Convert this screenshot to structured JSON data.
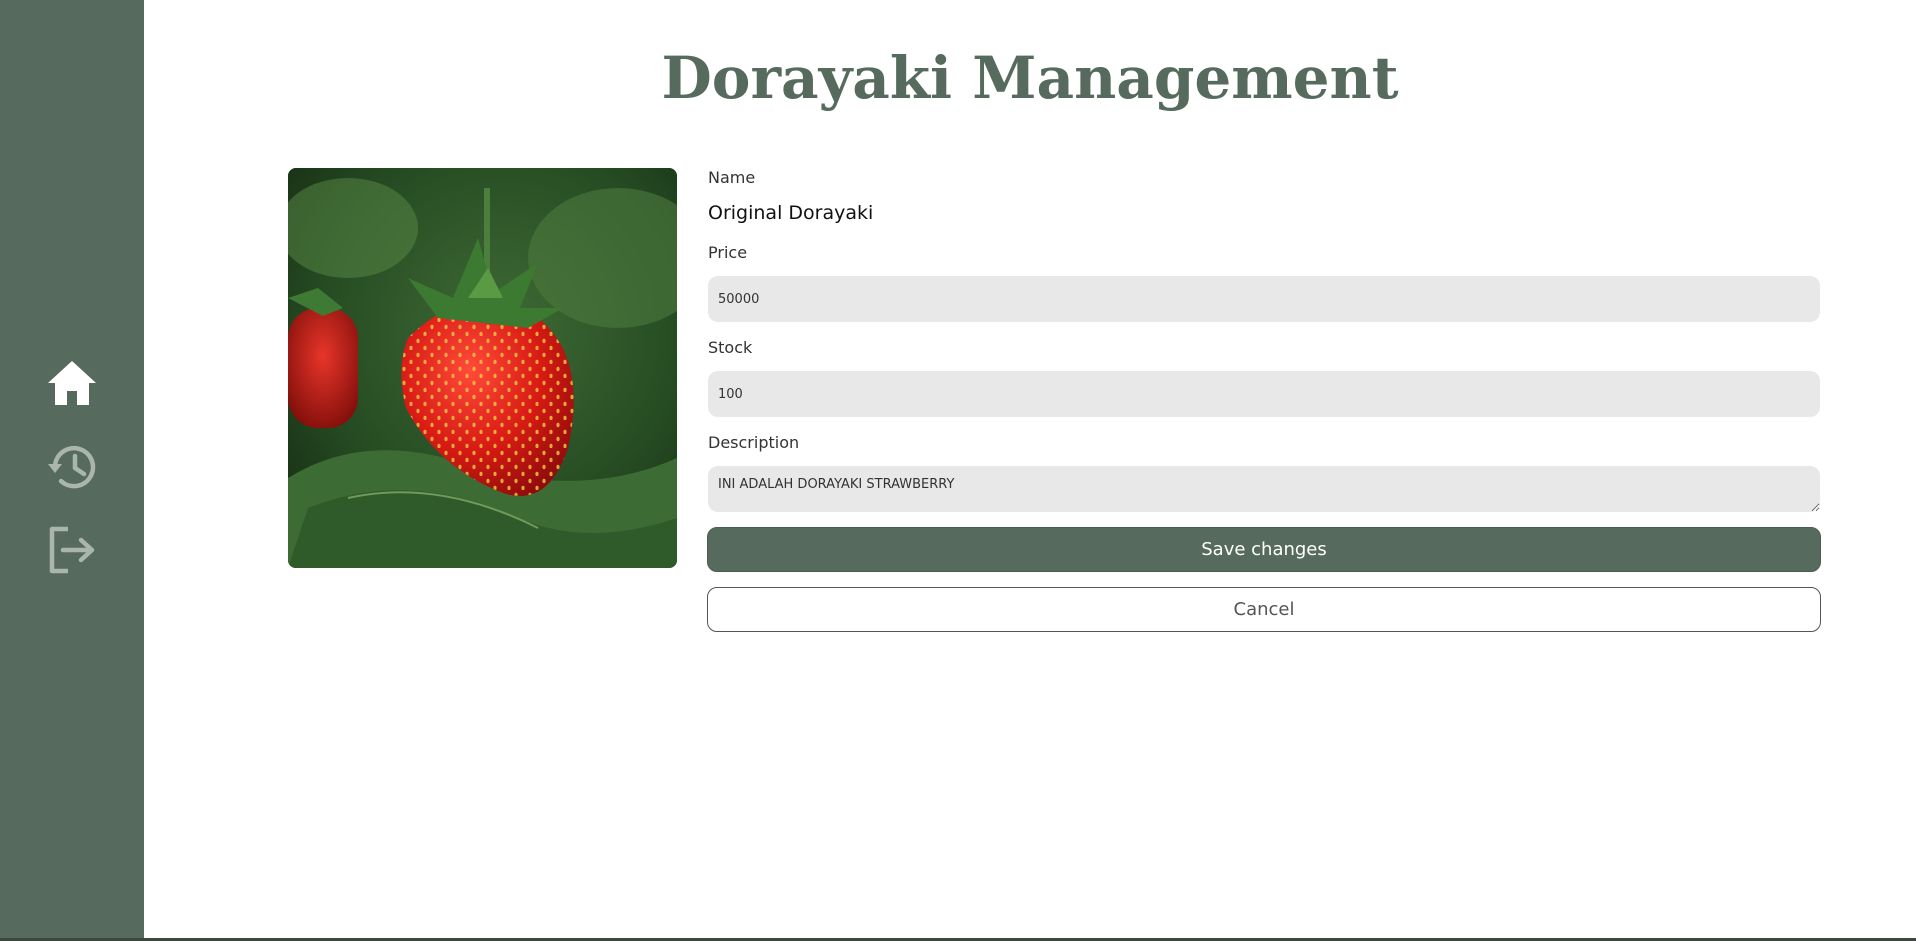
{
  "app": {
    "title": "Dorayaki Management"
  },
  "sidebar": {
    "items": [
      {
        "name": "home",
        "icon": "home-icon",
        "active": true
      },
      {
        "name": "history",
        "icon": "history-icon",
        "active": false
      },
      {
        "name": "logout",
        "icon": "logout-icon",
        "active": false
      }
    ]
  },
  "product": {
    "image_icon": "strawberry-photo"
  },
  "form": {
    "name_label": "Name",
    "name_value": "Original Dorayaki",
    "price_label": "Price",
    "price_value": "50000",
    "stock_label": "Stock",
    "stock_value": "100",
    "description_label": "Description",
    "description_value": "INI ADALAH DORAYAKI STRAWBERRY",
    "save_label": "Save changes",
    "cancel_label": "Cancel"
  },
  "colors": {
    "primary": "#566b5d",
    "field_bg": "#e8e8e8",
    "icon_active": "#ffffff",
    "icon_inactive": "#a9b5ad"
  }
}
